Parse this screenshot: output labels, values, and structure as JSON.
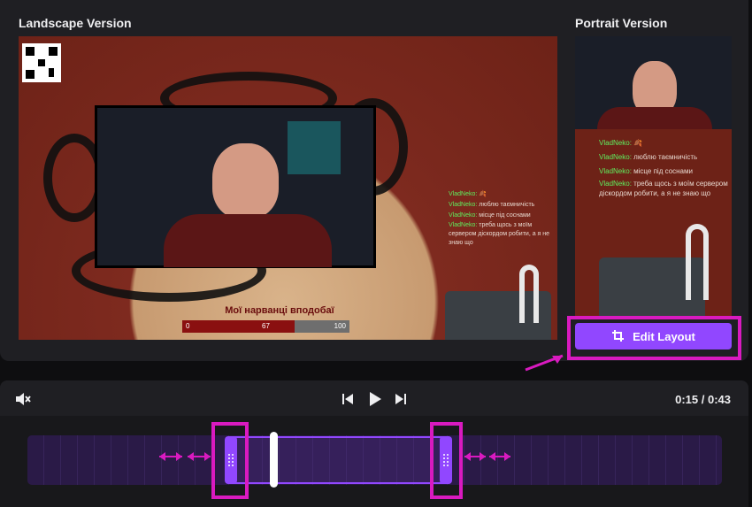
{
  "landscape": {
    "title": "Landscape Version",
    "chat": [
      {
        "name": "VladNeko:",
        "text": "🍂"
      },
      {
        "name": "VladNeko:",
        "text": "люблю таємничість"
      },
      {
        "name": "VladNeko:",
        "text": "місце під соснами"
      },
      {
        "name": "VladNeko:",
        "text": "треба щось з моїм сервером діскордом робити, а я не знаю що"
      }
    ],
    "progress": {
      "title": "Мої нарванці вподобаї",
      "min": "0",
      "current": "67",
      "max": "100",
      "fraction": 0.67
    }
  },
  "portrait": {
    "title": "Portrait Version",
    "chat": [
      {
        "name": "VladNeko:",
        "text": "🍂"
      },
      {
        "name": "VladNeko:",
        "text": "люблю таємничість"
      },
      {
        "name": "VladNeko:",
        "text": "місце під соснами"
      },
      {
        "name": "VladNeko:",
        "text": "треба щось з моїм сервером діскордом робити, а я не знаю що"
      }
    ]
  },
  "edit_layout": {
    "label": "Edit Layout",
    "icon": "crop-icon"
  },
  "controls": {
    "mute_icon": "volume-mute-icon",
    "prev_icon": "skip-back-icon",
    "play_icon": "play-icon",
    "next_icon": "skip-forward-icon",
    "time": "0:15 / 0:43"
  },
  "colors": {
    "accent": "#9147ff",
    "highlight": "#d91ac0",
    "panel": "#1f1f23"
  }
}
